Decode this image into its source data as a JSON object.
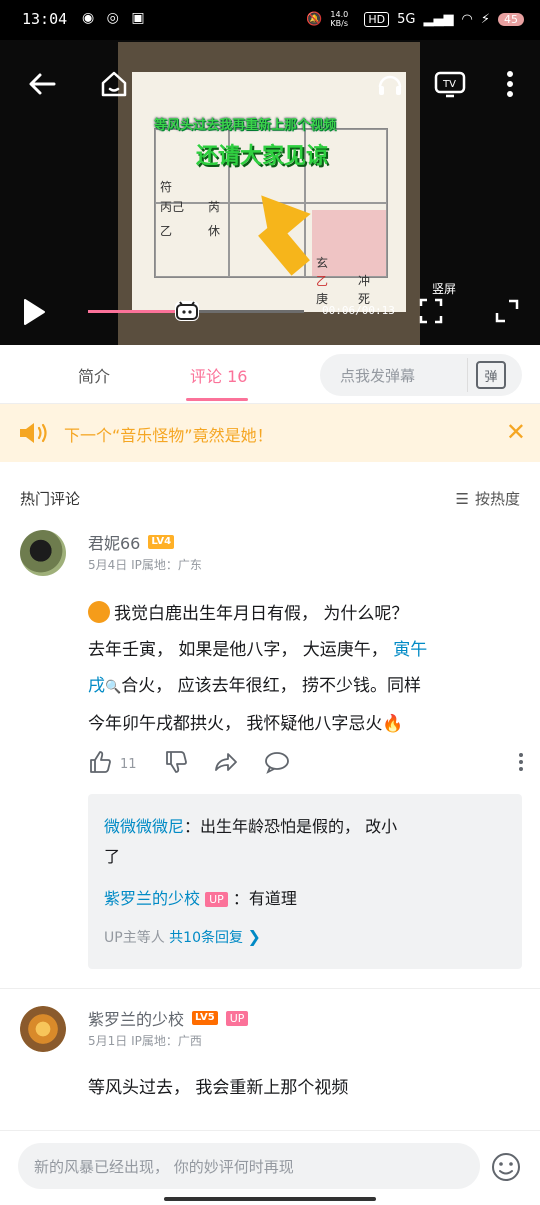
{
  "status_bar": {
    "time": "13:04",
    "net_speed": "14.0 KB/s",
    "hd_label": "HD",
    "network": "5G",
    "battery": "45"
  },
  "player": {
    "time_display": "00:06/00:13",
    "vertical_label": "竖屏",
    "progress_fraction": 0.46,
    "frame": {
      "caption_top": "等风头过去我再重新上那个视频",
      "caption_main": "还请大家见谅",
      "grid_cells": [
        "符",
        "丙己",
        "乙",
        "芮",
        "休",
        "玄",
        "乙",
        "庚",
        "冲",
        "死"
      ]
    }
  },
  "tabs": {
    "intro": "简介",
    "comments": "评论 16"
  },
  "danmu": {
    "placeholder": "点我发弹幕",
    "button": "弹"
  },
  "notice": {
    "text": "下一个“音乐怪物”竟然是她！"
  },
  "comments_header": {
    "title": "热门评论",
    "sort": "按热度"
  },
  "comments": [
    {
      "user": "君妮66",
      "level": "LV4",
      "meta": "5月4日  IP属地：广东",
      "text_line1": "我觉白鹿出生年月日有假， 为什么呢？",
      "text_line2": "去年壬寅， 如果是他八字， 大运庚午， ",
      "link_text_a": "寅午",
      "link_text_b": "戌",
      "text_line3": "合火， 应该去年很红， 捞不少钱。同样",
      "text_line4": "今年卯午戌都拱火， 我怀疑他八字忌火",
      "likes": "11",
      "replies": [
        {
          "user": "微微微微尼",
          "text": "：出生年龄恐怕是假的， 改小",
          "text2": "了"
        },
        {
          "user": "紫罗兰的少校",
          "badge": "UP",
          "text": "：有道理"
        }
      ],
      "reply_summary_prefix": "UP主等人",
      "reply_summary_count": "共10条回复"
    },
    {
      "user": "紫罗兰的少校",
      "level": "LV5",
      "badge": "UP",
      "meta": "5月1日  IP属地：广西",
      "text": "等风头过去， 我会重新上那个视频"
    }
  ],
  "bottom_input": {
    "placeholder": "新的风暴已经出现， 你的妙评何时再现"
  },
  "colors": {
    "accent_pink": "#fb7299",
    "link_blue": "#008ac5",
    "notice_orange": "#f5a623",
    "lv4": "#ffb027",
    "lv5": "#ff6c00"
  }
}
